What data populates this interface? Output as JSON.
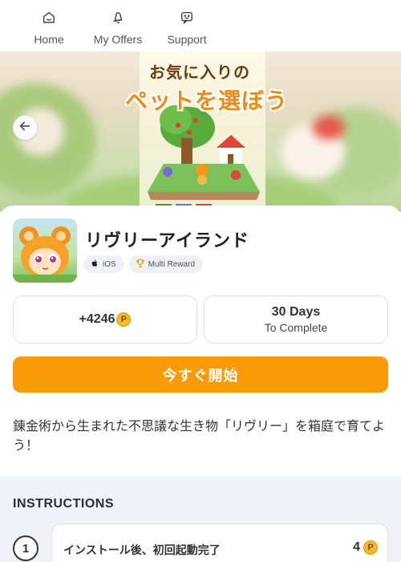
{
  "nav": {
    "items": [
      {
        "label": "Home",
        "icon": "home-icon"
      },
      {
        "label": "My Offers",
        "icon": "bell-icon"
      },
      {
        "label": "Support",
        "icon": "chat-icon"
      }
    ]
  },
  "hero": {
    "poster_line1": "お気に入りの",
    "poster_line2": "ペットを選ぼう",
    "back_icon": "arrow-left-icon"
  },
  "app": {
    "title": "リヴリーアイランド",
    "badges": [
      {
        "label": "iOS",
        "icon": "apple-icon"
      },
      {
        "label": "Multi Reward",
        "icon": "trophy-icon"
      }
    ]
  },
  "stats": {
    "points": "+4246",
    "coin_symbol": "P",
    "days": "30 Days",
    "days_sub": "To Complete"
  },
  "cta": {
    "label": "今すぐ開始"
  },
  "description": "錬金術から生まれた不思議な生き物「リヴリー」を箱庭で育てよう！",
  "instructions": {
    "title": "INSTRUCTIONS",
    "steps": [
      {
        "number": "1",
        "text": "インストール後、初回起動完了",
        "points": "4",
        "coin_symbol": "P"
      }
    ]
  },
  "colors": {
    "accent": "#f99a08",
    "coin": "#f5b82e",
    "section_bg": "#eff2f6"
  }
}
